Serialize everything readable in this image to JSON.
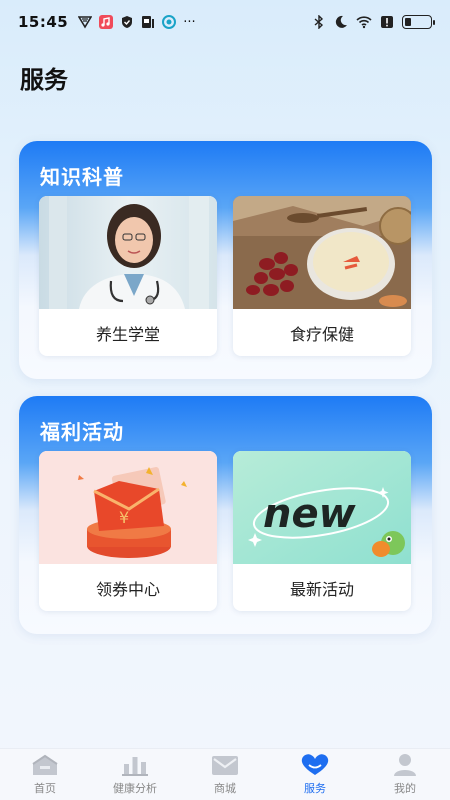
{
  "status_bar": {
    "time": "15:45",
    "left_icons": [
      "vpn-icon",
      "music-icon",
      "shield-icon",
      "sim-icon",
      "eye-icon",
      "more-dots-icon"
    ],
    "right_icons": [
      "bluetooth-icon",
      "moon-icon",
      "wifi-icon",
      "alert-icon",
      "battery-icon"
    ],
    "more": "···"
  },
  "page": {
    "title": "服务"
  },
  "sections": [
    {
      "title": "知识科普",
      "cards": [
        {
          "label": "养生学堂",
          "image": "doctor-photo"
        },
        {
          "label": "食疗保健",
          "image": "food-photo"
        }
      ]
    },
    {
      "title": "福利活动",
      "cards": [
        {
          "label": "领券中心",
          "image": "red-envelope-image"
        },
        {
          "label": "最新活动",
          "image": "new-banner-image",
          "banner_text": "new"
        }
      ]
    }
  ],
  "tabbar": {
    "items": [
      {
        "label": "首页",
        "icon": "home-icon",
        "active": false
      },
      {
        "label": "健康分析",
        "icon": "bar-chart-icon",
        "active": false
      },
      {
        "label": "商城",
        "icon": "mail-icon",
        "active": false
      },
      {
        "label": "服务",
        "icon": "heart-icon",
        "active": true
      },
      {
        "label": "我的",
        "icon": "person-icon",
        "active": false
      }
    ]
  },
  "colors": {
    "accent": "#1e6ef0",
    "inactive": "#888888",
    "section_top": "#1e7bf5"
  }
}
